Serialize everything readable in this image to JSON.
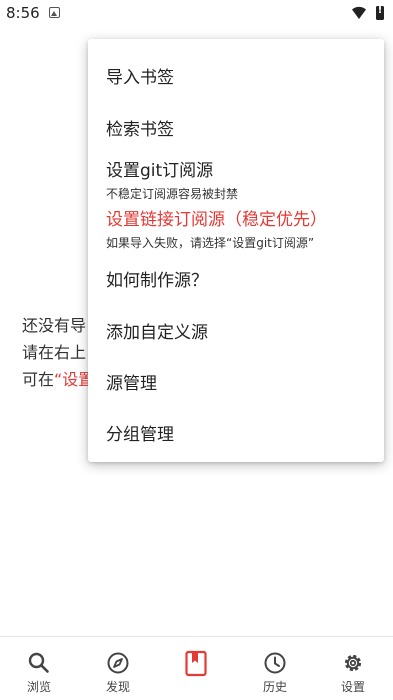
{
  "status_bar": {
    "time": "8:56"
  },
  "background": {
    "empty_lines": [
      "还没有导",
      "请在右上",
      "可在"
    ],
    "empty_line3_accent": "“设置"
  },
  "menu": {
    "items": [
      {
        "label": "导入书签",
        "sub": ""
      },
      {
        "label": "检索书签",
        "sub": ""
      },
      {
        "label": "设置git订阅源",
        "sub": "不稳定订阅源容易被封禁"
      },
      {
        "label": "设置链接订阅源（稳定优先）",
        "sub": "如果导入失败，请选择“设置git订阅源”"
      },
      {
        "label": "如何制作源？",
        "sub": ""
      },
      {
        "label": "添加自定义源",
        "sub": ""
      },
      {
        "label": "源管理",
        "sub": ""
      },
      {
        "label": "分组管理",
        "sub": ""
      }
    ]
  },
  "bottom_nav": {
    "items": [
      {
        "label": "浏览",
        "icon": "search-icon"
      },
      {
        "label": "发现",
        "icon": "compass-icon"
      },
      {
        "label": "",
        "icon": "bookmark-icon"
      },
      {
        "label": "历史",
        "icon": "clock-icon"
      },
      {
        "label": "设置",
        "icon": "gear-icon"
      }
    ]
  },
  "colors": {
    "accent": "#e53935",
    "text": "#222222"
  }
}
